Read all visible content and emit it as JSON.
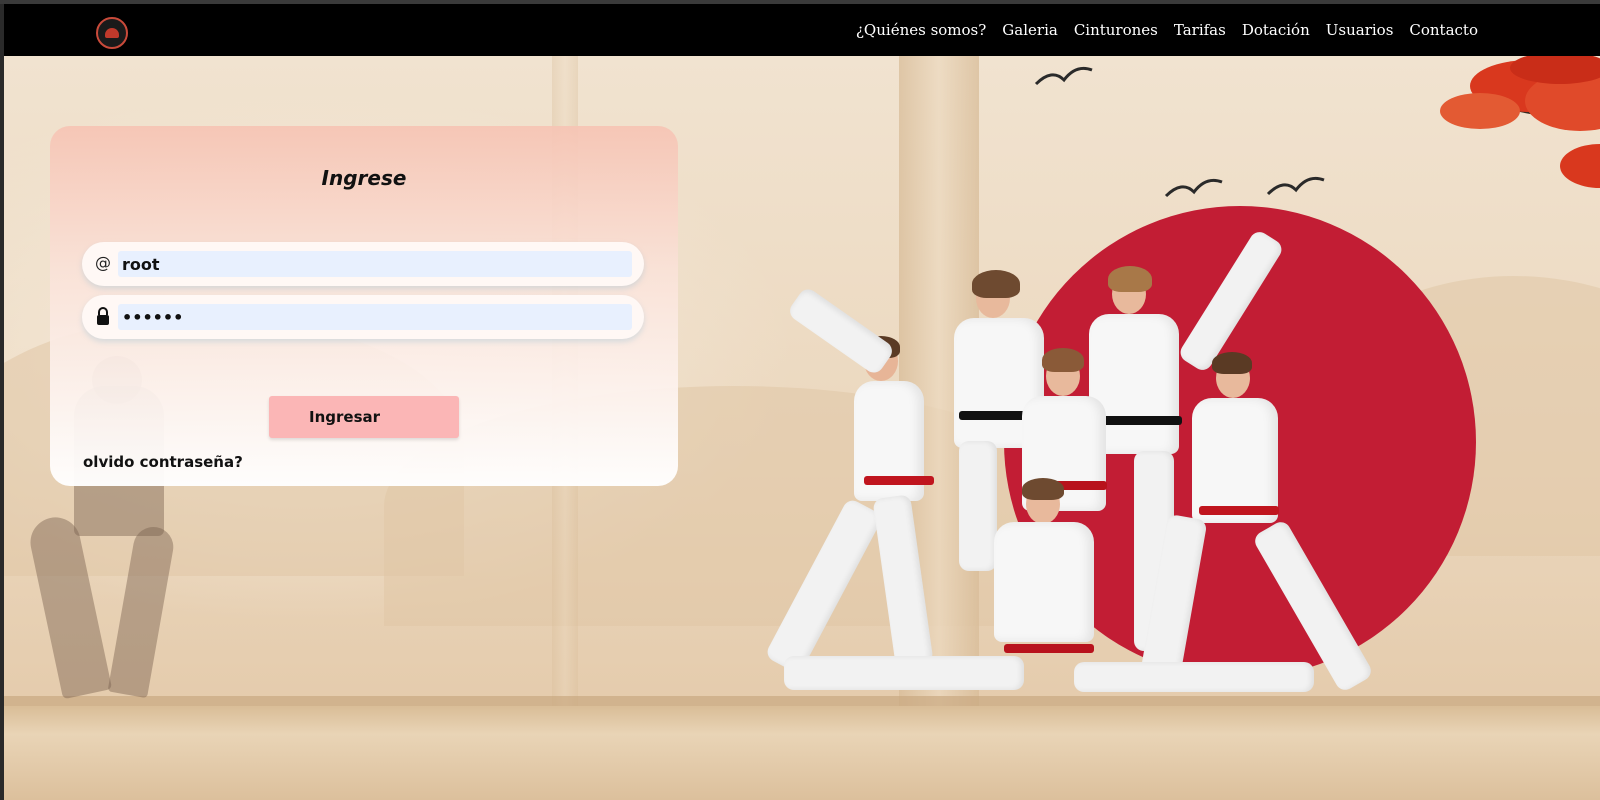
{
  "nav": {
    "logo_icon": "dojo-logo-icon",
    "links": [
      "¿Quiénes somos?",
      "Galeria",
      "Cinturones",
      "Tarifas",
      "Dotación",
      "Usuarios",
      "Contacto"
    ]
  },
  "login": {
    "title": "Ingrese",
    "username_icon": "@",
    "username_value": "root",
    "password_icon": "lock-icon",
    "password_value": "••••••",
    "submit_label": "Ingresar",
    "forgot_label": "olvido contraseña?"
  },
  "colors": {
    "navbar": "#000000",
    "accent_red": "#c21d34",
    "button": "#fbb6b6",
    "input_bg": "#e8f0fe"
  }
}
